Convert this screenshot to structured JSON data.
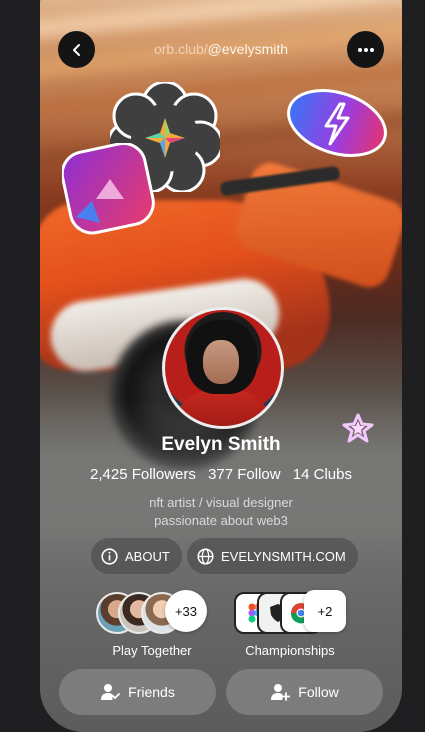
{
  "header": {
    "handle_prefix": "orb.club/",
    "handle": "@evelysmith",
    "back_icon": "chevron-left-icon",
    "menu_icon": "more-horizontal-icon"
  },
  "profile": {
    "name": "Evelyn Smith",
    "followers": "2,425 Followers",
    "following": "377 Follow",
    "clubs": "14 Clubs",
    "bio_line1": "nft artist / visual designer",
    "bio_line2": "passionate about web3"
  },
  "links": {
    "about_label": "ABOUT",
    "website_label": "EVELYNSMITH.COM"
  },
  "groups": {
    "play_together": {
      "label": "Play Together",
      "more": "+33"
    },
    "championships": {
      "label": "Championships",
      "more": "+2"
    }
  },
  "actions": {
    "friends_label": "Friends",
    "follow_label": "Follow"
  },
  "colors": {
    "accent_blue": "#3b6ef6",
    "accent_pink": "#e0357a",
    "accent_purple": "#7b3ed6"
  }
}
